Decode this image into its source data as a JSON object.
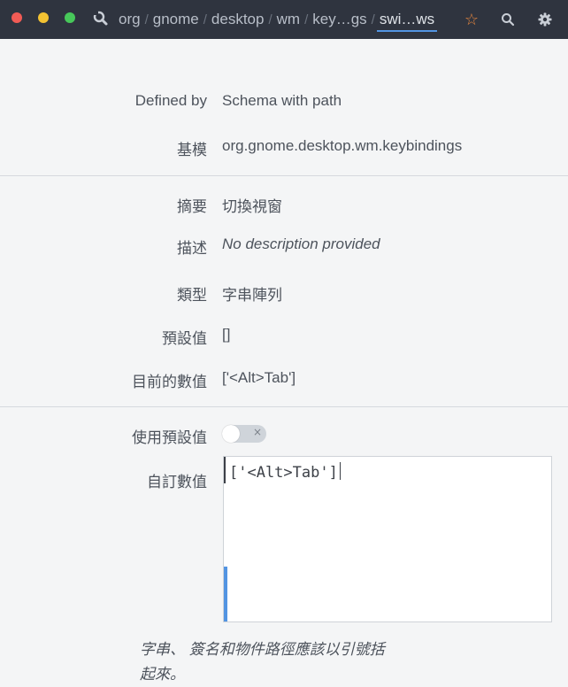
{
  "titlebar": {
    "breadcrumbs": [
      "org",
      "gnome",
      "desktop",
      "wm",
      "key…gs",
      "swi…ws"
    ],
    "separator": "/",
    "star_icon": "☆",
    "colors": {
      "bar": "#2f343f",
      "accent": "#5294e2",
      "close": "#f15b55",
      "minimize": "#f3c232",
      "maximize": "#47c85a",
      "star": "#e6863e"
    }
  },
  "schema": {
    "defined_by_label": "Defined by",
    "defined_by_value": "Schema with path",
    "schema_label": "基模",
    "schema_value": "org.gnome.desktop.wm.keybindings"
  },
  "info": {
    "summary_label": "摘要",
    "summary_value": "切換視窗",
    "description_label": "描述",
    "description_value": "No description provided",
    "type_label": "類型",
    "type_value": "字串陣列",
    "default_label": "預設值",
    "default_value": "[]",
    "current_label": "目前的數值",
    "current_value": "['<Alt>Tab']"
  },
  "custom": {
    "use_default_label": "使用預設值",
    "use_default_on": false,
    "switch_off_glyph": "×",
    "custom_value_label": "自訂數值",
    "custom_value": "['<Alt>Tab']",
    "hint_line1": "字串、 簽名和物件路徑應該以引號括",
    "hint_line2": "起來。"
  }
}
